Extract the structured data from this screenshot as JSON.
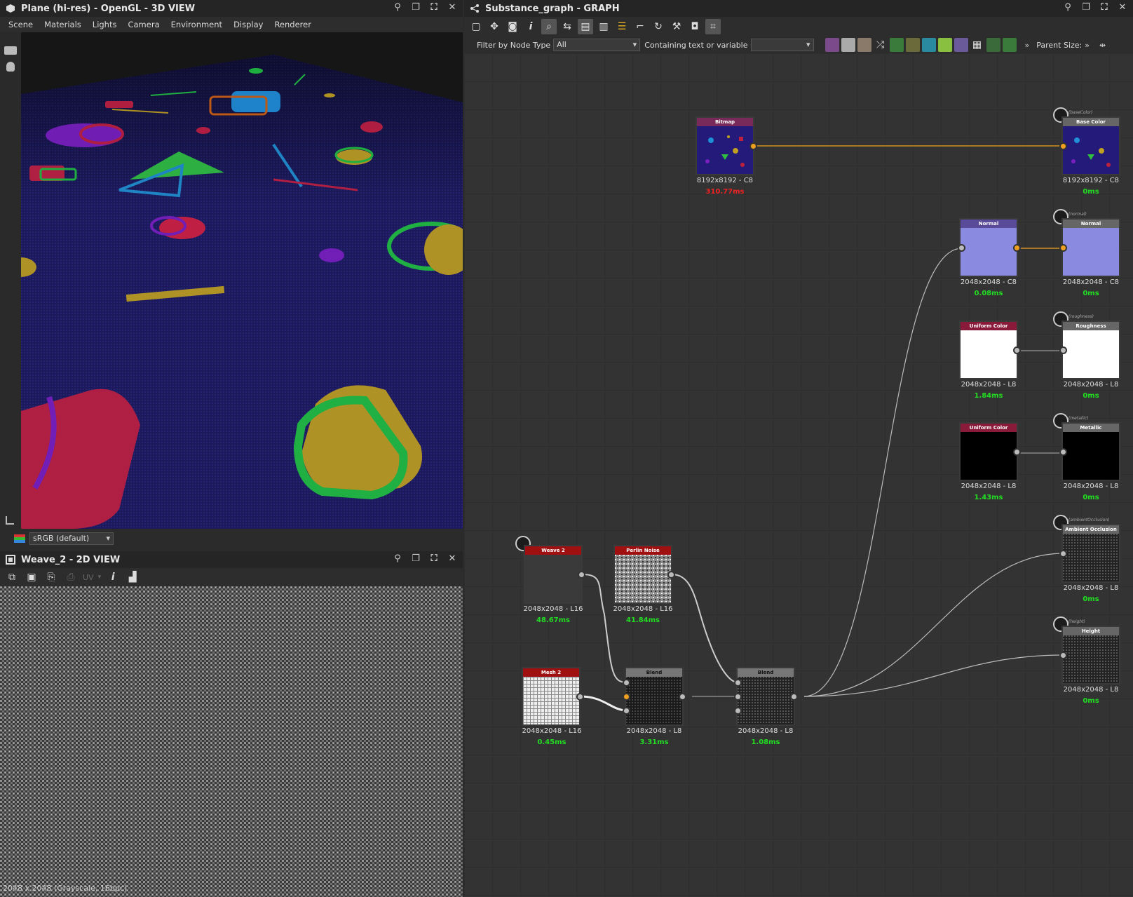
{
  "view3d": {
    "title": "Plane (hi-res) - OpenGL - 3D VIEW",
    "menu": [
      "Scene",
      "Materials",
      "Lights",
      "Camera",
      "Environment",
      "Display",
      "Renderer"
    ],
    "colorspace": "sRGB (default)"
  },
  "view2d": {
    "title": "Weave_2 - 2D VIEW",
    "uv_label": "UV",
    "status": "2048 x 2048 (Grayscale, 16bpc)"
  },
  "graph": {
    "title": "Substance_graph - GRAPH",
    "filter_label": "Filter by Node Type",
    "filter_value": "All",
    "containing_label": "Containing text or variable",
    "containing_value": "",
    "parent_size_label": "Parent Size:",
    "nodes": {
      "bitmap": {
        "header": "Bitmap",
        "res": "8192x8192 - C8",
        "time": "310.77ms"
      },
      "basecolor_out": {
        "tag": "(baseColor)",
        "header": "Base Color",
        "res": "8192x8192 - C8",
        "time": "0ms"
      },
      "normal": {
        "header": "Normal",
        "res": "2048x2048 - C8",
        "time": "0.08ms"
      },
      "normal_out": {
        "tag": "(normal)",
        "header": "Normal",
        "res": "2048x2048 - C8",
        "time": "0ms"
      },
      "uniform1": {
        "header": "Uniform Color",
        "res": "2048x2048 - L8",
        "time": "1.84ms"
      },
      "roughness_out": {
        "tag": "(roughness)",
        "header": "Roughness",
        "res": "2048x2048 - L8",
        "time": "0ms"
      },
      "uniform2": {
        "header": "Uniform Color",
        "res": "2048x2048 - L8",
        "time": "1.43ms"
      },
      "metallic_out": {
        "tag": "(metallic)",
        "header": "Metallic",
        "res": "2048x2048 - L8",
        "time": "0ms"
      },
      "ao_out": {
        "tag": "(ambientOcclusion)",
        "header": "Ambient Occlusion",
        "res": "2048x2048 - L8",
        "time": "0ms"
      },
      "height_out": {
        "tag": "(height)",
        "header": "Height",
        "res": "2048x2048 - L8",
        "time": "0ms"
      },
      "weave": {
        "header": "Weave 2",
        "res": "2048x2048 - L16",
        "time": "48.67ms"
      },
      "perlin": {
        "header": "Perlin Noise",
        "res": "2048x2048 - L16",
        "time": "41.84ms"
      },
      "mesh": {
        "header": "Mesh 2",
        "res": "2048x2048 - L16",
        "time": "0.45ms"
      },
      "blend1": {
        "header": "Blend",
        "res": "2048x2048 - L8",
        "time": "3.31ms"
      },
      "blend2": {
        "header": "Blend",
        "res": "2048x2048 - L8",
        "time": "1.08ms"
      }
    }
  },
  "colors": {
    "time_ok": "#22dd22",
    "time_slow": "#ee2222",
    "port_active": "#f0a020",
    "link_color": "#d09020"
  }
}
